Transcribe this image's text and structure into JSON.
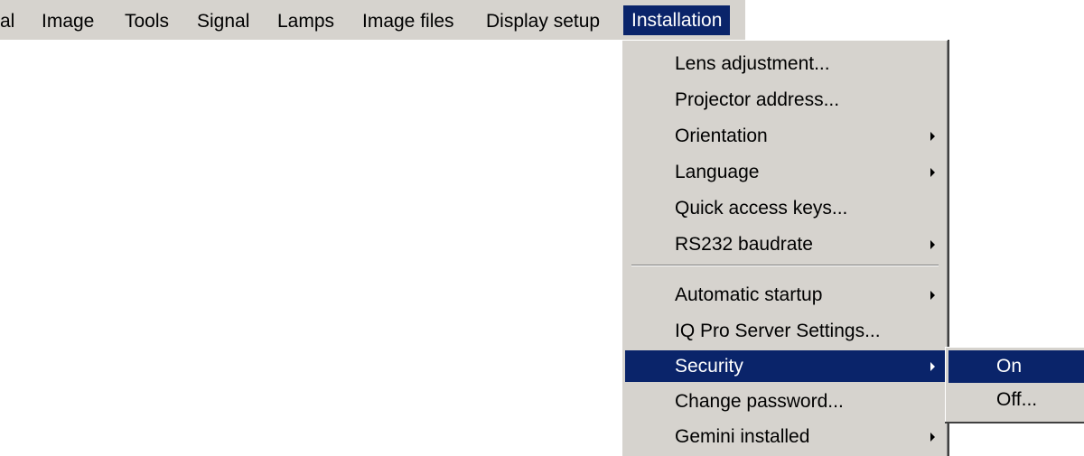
{
  "menubar": {
    "items": [
      {
        "label": "al"
      },
      {
        "label": "Image"
      },
      {
        "label": "Tools"
      },
      {
        "label": "Signal"
      },
      {
        "label": "Lamps"
      },
      {
        "label": "Image files"
      },
      {
        "label": "Display setup"
      },
      {
        "label": "Installation",
        "active": true
      }
    ]
  },
  "installation_menu": {
    "items": [
      {
        "label": "Lens adjustment..."
      },
      {
        "label": "Projector address..."
      },
      {
        "label": "Orientation",
        "submenu": true
      },
      {
        "label": "Language",
        "submenu": true
      },
      {
        "label": "Quick access keys..."
      },
      {
        "label": "RS232 baudrate",
        "submenu": true
      },
      {
        "label": "Automatic startup",
        "submenu": true
      },
      {
        "label": "IQ Pro Server Settings..."
      },
      {
        "label": "Security",
        "submenu": true,
        "highlighted": true
      },
      {
        "label": "Change password..."
      },
      {
        "label": "Gemini installed",
        "submenu": true
      }
    ]
  },
  "security_submenu": {
    "items": [
      {
        "label": "On",
        "highlighted": true
      },
      {
        "label": "Off..."
      }
    ]
  },
  "colors": {
    "highlight": "#0a246a",
    "menu_background": "#d6d3ce"
  }
}
